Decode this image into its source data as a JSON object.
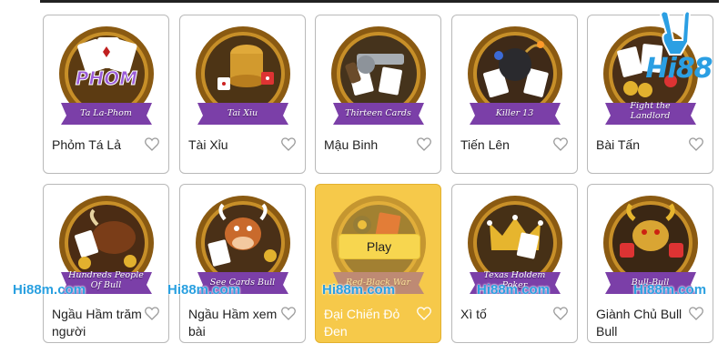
{
  "logo": {
    "text": "Hi88",
    "icon": "victory-hand-icon",
    "color": "#2b9fe3"
  },
  "watermark": "Hi88m.com",
  "accent_color": "#f6c94a",
  "games": [
    {
      "name": "Phỏm Tá Lả",
      "banner": "Ta La-Phom",
      "art_text": "PHOM",
      "icon": "playing-cards-icon"
    },
    {
      "name": "Tài Xỉu",
      "banner": "Tai Xiu",
      "icon": "dice-cup-icon"
    },
    {
      "name": "Mậu Binh",
      "banner": "Thirteen Cards",
      "icon": "revolver-icon"
    },
    {
      "name": "Tiến Lên",
      "banner": "Killer 13",
      "icon": "bomb-icon"
    },
    {
      "name": "Bài Tấn",
      "banner": "Fight the Landlord",
      "icon": "cards-chips-icon"
    },
    {
      "name": "Ngầu Hầm trăm người",
      "banner": "Hundreds People Of Bull",
      "icon": "bull-icon"
    },
    {
      "name": "Ngầu Hầm xem bài",
      "banner": "See Cards Bull",
      "icon": "cartoon-bull-icon"
    },
    {
      "name": "Đại Chiến Đỏ Đen",
      "banner": "Red-Black War",
      "icon": "chips-cards-icon",
      "active": true,
      "play_label": "Play"
    },
    {
      "name": "Xì tố",
      "banner": "Texas Holdem Poker",
      "icon": "crown-icon"
    },
    {
      "name": "Giành Chủ Bull Bull",
      "banner": "Bull-Bull",
      "icon": "golden-bull-icon"
    }
  ]
}
